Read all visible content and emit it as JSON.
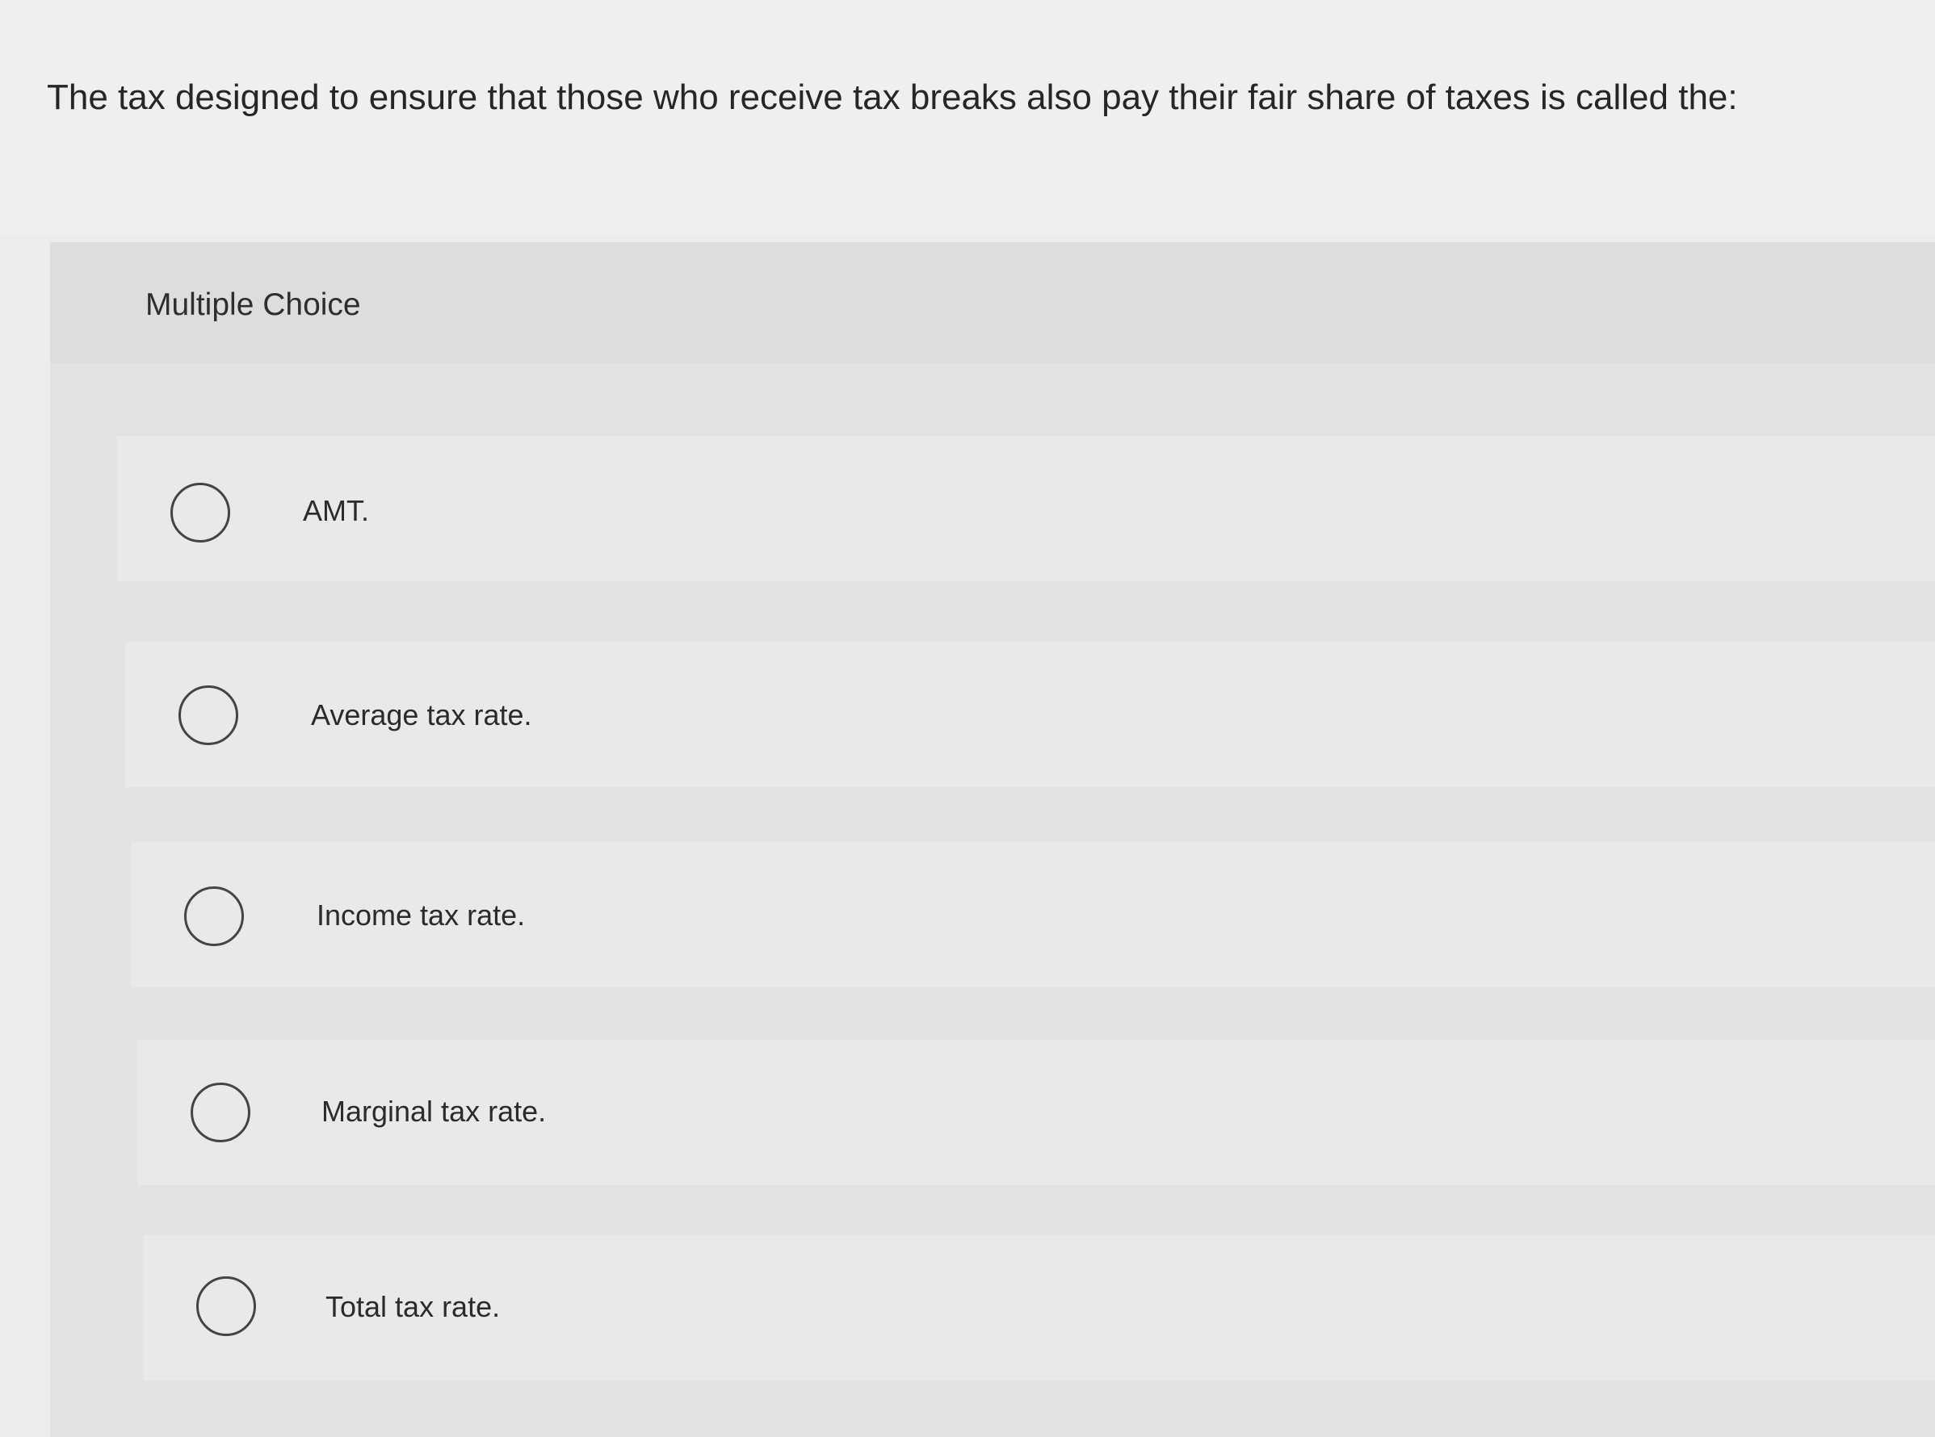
{
  "question": {
    "text": "The tax designed to ensure that those who receive tax breaks also pay their fair share of taxes is called the:"
  },
  "multiple_choice": {
    "heading": "Multiple Choice",
    "options": [
      {
        "label": "AMT.",
        "selected": false
      },
      {
        "label": "Average tax rate.",
        "selected": false
      },
      {
        "label": "Income tax rate.",
        "selected": false
      },
      {
        "label": "Marginal tax rate.",
        "selected": false
      },
      {
        "label": "Total tax rate.",
        "selected": false
      }
    ]
  }
}
